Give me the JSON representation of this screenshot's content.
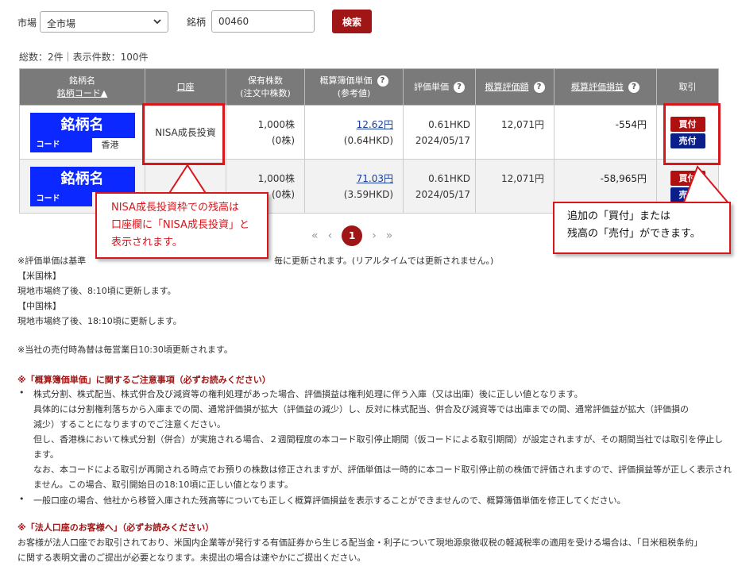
{
  "search": {
    "market_label": "市場",
    "market_value": "全市場",
    "symbol_label": "銘柄",
    "symbol_value": "00460",
    "search_button": "検索"
  },
  "summary": "総数：2件｜表示件数：100件",
  "table": {
    "headers": {
      "name_line1": "銘柄名",
      "name_line2": "銘柄コード▲",
      "account": "口座",
      "holdings_line1": "保有株数",
      "holdings_line2": "(注文中株数)",
      "book_line1": "概算簿価単価",
      "book_line2": "(参考値)",
      "eval_unit": "評価単価",
      "eval_amount": "概算評価額",
      "eval_pl": "概算評価損益",
      "trade": "取引"
    },
    "help_icon": "?",
    "rows": [
      {
        "name": "銘柄名",
        "code": "コード",
        "market": "香港",
        "account": "NISA成長投資",
        "shares": "1,000株",
        "pending": "(0株)",
        "book_price": "12.62円",
        "book_hkd": "(0.64HKD)",
        "eval_unit": "0.61HKD",
        "eval_date": "2024/05/17",
        "eval_amount": "12,071円",
        "eval_pl": "-554円",
        "buy": "買付",
        "sell": "売付"
      },
      {
        "name": "銘柄名",
        "code": "コード",
        "market": "",
        "account": "",
        "shares": "1,000株",
        "pending": "(0株)",
        "book_price": "71.03円",
        "book_hkd": "(3.59HKD)",
        "eval_unit": "0.61HKD",
        "eval_date": "2024/05/17",
        "eval_amount": "12,071円",
        "eval_pl": "-58,965円",
        "buy": "買付",
        "sell": "売付"
      }
    ]
  },
  "callouts": {
    "left_line1": "NISA成長投資枠での残高は",
    "left_line2": "口座欄に「NISA成長投資」と",
    "left_line3": "表示されます。",
    "right_line1": "追加の「買付」または",
    "right_line2": "残高の「売付」ができます。"
  },
  "pager": {
    "first": "«",
    "prev": "‹",
    "current": "1",
    "next": "›",
    "last": "»"
  },
  "notes": {
    "n1a": "※評価単価は基準",
    "n1b": "毎に更新されます。(リアルタイムでは更新されません。)",
    "n2": "【米国株】",
    "n3": "現地市場終了後、8:10頃に更新します。",
    "n4": "【中国株】",
    "n5": "現地市場終了後、18:10頃に更新します。",
    "n6": "※当社の売付時為替は毎営業日10:30頃更新されます。",
    "h1": "※「概算簿価単価」に関するご注意事項（必ずお読みください）",
    "b1": "株式分割、株式配当、株式併合及び減資等の権利処理があった場合、評価損益は権利処理に伴う入庫（又は出庫）後に正しい値となります。",
    "b1a": "具体的には分割権利落ちから入庫までの間、通常評価損が拡大（評価益の減少）し、反対に株式配当、併合及び減資等では出庫までの間、通常評価益が拡大（評価損の",
    "b1b": "減少）することになりますのでご注意ください。",
    "b1c": "但し、香港株において株式分割（併合）が実施される場合、２週間程度の本コード取引停止期間（仮コードによる取引期間）が設定されますが、その期間当社では取引を停止し",
    "b1d": "ます。",
    "b1e": "なお、本コードによる取引が再開される時点でお預りの株数は修正されますが、評価単価は一時的に本コード取引停止前の株価で評価されますので、評価損益等が正しく表示され",
    "b1f": "ません。この場合、取引開始日の18:10頃に正しい値となります。",
    "b2": "一般口座の場合、他社から移管入庫された残高等についても正しく概算評価損益を表示することができませんので、概算簿価単価を修正してください。",
    "h2": "※「法人口座のお客様へ」（必ずお読みください）",
    "c1": "お客様が法人口座でお取引されており、米国内企業等が発行する有価証券から生じる配当金・利子について現地源泉徴収税の軽減税率の適用を受ける場合は、「日米租税条約」",
    "c2": "に関する表明文書のご提出が必要となります。未提出の場合は速やかにご提出ください。",
    "bullet": "•"
  }
}
